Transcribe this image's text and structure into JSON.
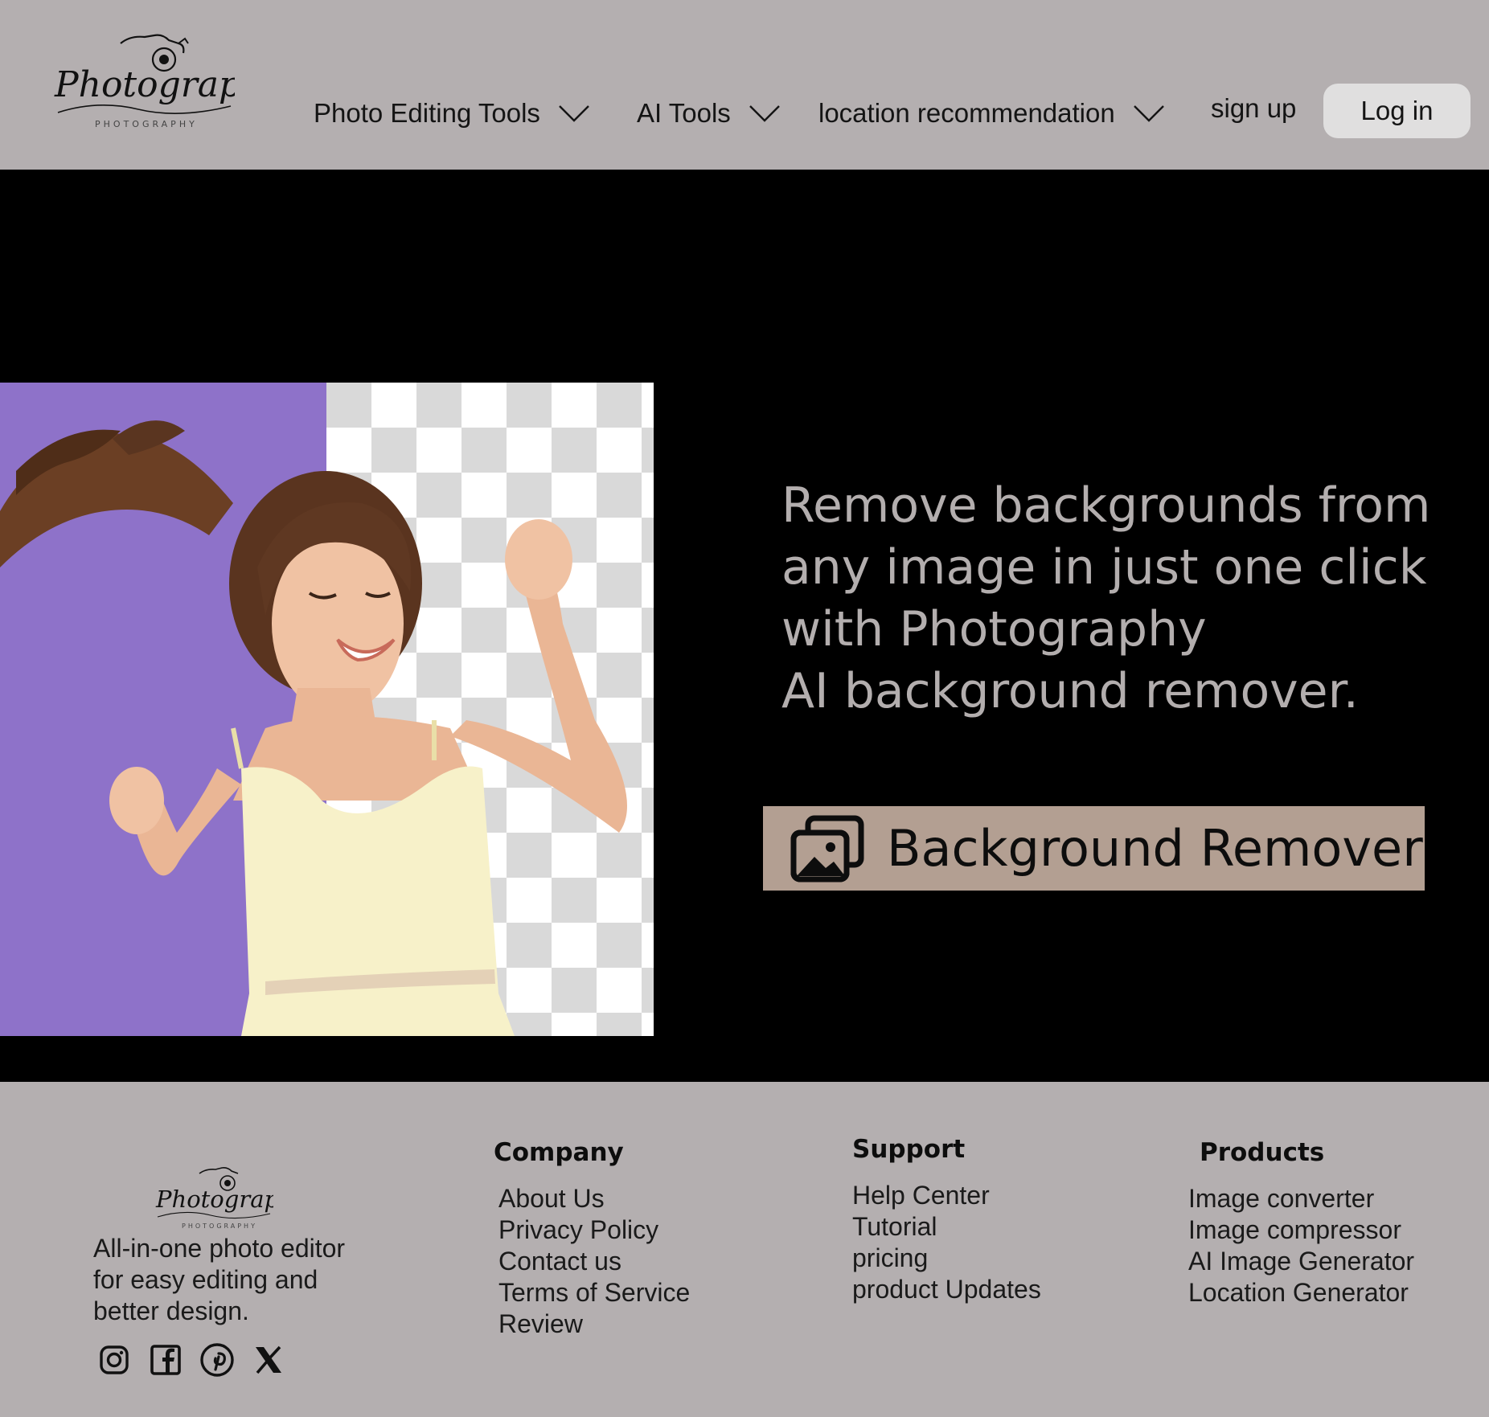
{
  "header": {
    "logo": {
      "script": "Photography",
      "sub": "PHOTOGRAPHY"
    },
    "nav": [
      {
        "label": "Photo Editing Tools"
      },
      {
        "label": "AI Tools"
      },
      {
        "label": "location recommendation"
      }
    ],
    "signup_label": "sign up",
    "login_label": "Log in"
  },
  "hero": {
    "headline": [
      "Remove backgrounds from",
      "any image in just one click",
      "with Photography",
      "AI background remover."
    ],
    "cta_label": "Background Remover"
  },
  "footer": {
    "logo": {
      "script": "Photography",
      "sub": "PHOTOGRAPHY"
    },
    "tagline": [
      "All-in-one photo editor",
      "for easy editing and",
      "better design."
    ],
    "socials": [
      "instagram-icon",
      "facebook-icon",
      "pinterest-icon",
      "x-icon"
    ],
    "columns": {
      "company": {
        "title": "Company",
        "links": [
          "About Us",
          "Privacy Policy",
          "Contact us",
          "Terms of Service",
          "Review"
        ]
      },
      "support": {
        "title": "Support",
        "links": [
          "Help Center",
          "Tutorial",
          "pricing",
          "product Updates"
        ]
      },
      "products": {
        "title": "Products",
        "links": [
          "Image converter",
          "Image compressor",
          "AI Image Generator",
          "Location Generator"
        ]
      }
    }
  },
  "colors": {
    "header_bg": "#b4afb0",
    "hero_bg": "#000000",
    "headline": "#b3aeae",
    "cta_bg": "#b39f92",
    "login_bg": "#e0dfdf",
    "photo_bg": "#8e72c9"
  }
}
